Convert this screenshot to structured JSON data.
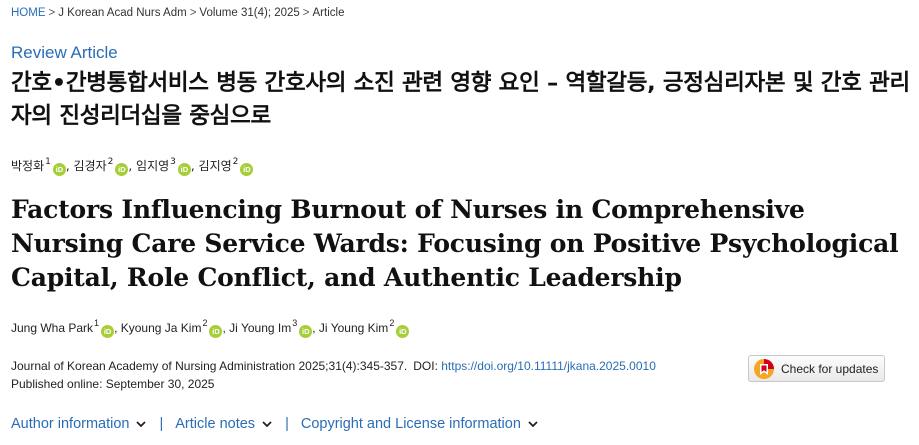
{
  "breadcrumb": {
    "items": [
      "HOME",
      "J Korean Acad Nurs Adm",
      "Volume 31(4); 2025",
      "Article"
    ],
    "separator": ">"
  },
  "article_type": "Review Article",
  "title_ko": "간호•간병통합서비스 병동 간호사의 소진 관련 영향 요인 – 역할갈등, 긍정심리자본 및 간호 관리자의 진성리더십을 중심으로",
  "authors_ko": [
    {
      "name": "박정화",
      "aff": "1",
      "sep": ","
    },
    {
      "name": "김경자",
      "aff": "2",
      "sep": ","
    },
    {
      "name": "임지영",
      "aff": "3",
      "sep": ","
    },
    {
      "name": "김지영",
      "aff": "2",
      "sep": ""
    }
  ],
  "title_en": "Factors Influencing Burnout of Nurses in Comprehensive Nursing Care Service Wards: Focusing on Positive Psychological Capital, Role Conflict, and Authentic Leadership",
  "authors_en": [
    {
      "name": "Jung Wha Park",
      "aff": "1",
      "sep": ","
    },
    {
      "name": "Kyoung Ja Kim",
      "aff": "2",
      "sep": ","
    },
    {
      "name": "Ji Young Im",
      "aff": "3",
      "sep": ","
    },
    {
      "name": "Ji Young Kim",
      "aff": "2",
      "sep": ""
    }
  ],
  "orcid_label": "iD",
  "citation": {
    "journal": "Journal of Korean Academy of Nursing Administration 2025;31(4):345-357.",
    "doi_label": "DOI:",
    "doi_url": "https://doi.org/10.11111/jkana.2025.0010",
    "published": "Published online: September 30, 2025"
  },
  "check_updates_label": "Check for updates",
  "info_links": [
    "Author information",
    "Article notes",
    "Copyright and License information"
  ],
  "colors": {
    "link": "#2a6db5",
    "orcid": "#a6ce39",
    "badge_red": "#d0021b",
    "badge_yellow": "#f5a623"
  }
}
